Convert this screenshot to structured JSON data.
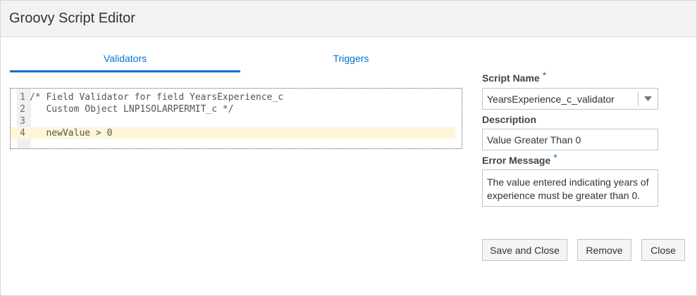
{
  "dialog": {
    "title": "Groovy Script Editor"
  },
  "tabs": [
    {
      "label": "Validators",
      "selected": true
    },
    {
      "label": "Triggers",
      "selected": false
    }
  ],
  "editor": {
    "lines": [
      {
        "number": "1",
        "text": "/* Field Validator for field YearsExperience_c"
      },
      {
        "number": "2",
        "text": "   Custom Object LNP1SOLARPERMIT_c */"
      },
      {
        "number": "3",
        "text": ""
      },
      {
        "number": "4",
        "text": "   newValue > 0"
      }
    ],
    "active_line": 4,
    "active_line_color": "#fdf6d8"
  },
  "form": {
    "script_name": {
      "label": "Script Name",
      "required_marker": "*",
      "value": "YearsExperience_c_validator"
    },
    "description": {
      "label": "Description",
      "value": "Value Greater Than 0"
    },
    "error_message": {
      "label": "Error Message",
      "required_marker": "*",
      "value": "The value entered indicating years of experience must be greater than 0."
    }
  },
  "buttons": {
    "save_close": "Save and Close",
    "remove": "Remove",
    "close": "Close"
  },
  "icons": {
    "dropdown": "chevron-down-icon"
  },
  "colors": {
    "accent": "#0572ce",
    "title_bar": "#f2f2f2"
  }
}
